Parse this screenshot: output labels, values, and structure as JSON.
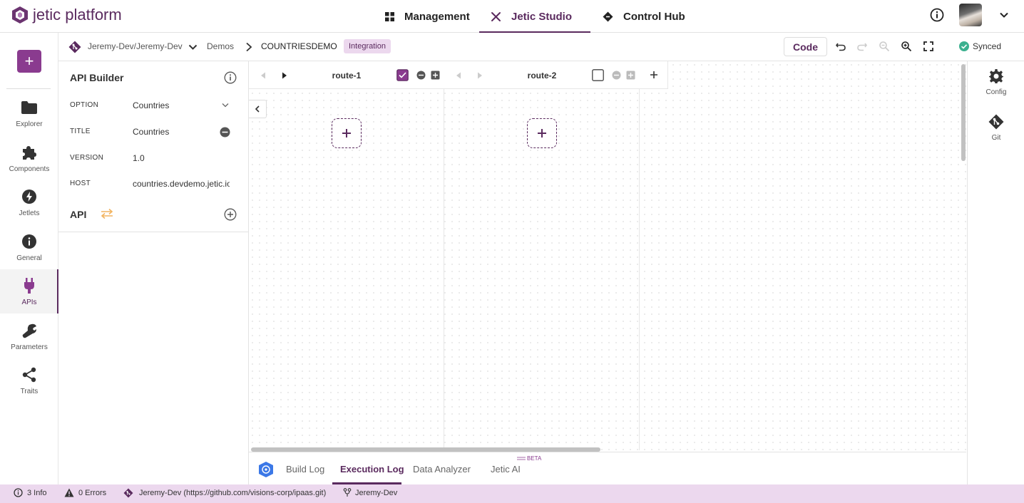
{
  "brand": {
    "name": "jetic platform"
  },
  "nav": {
    "tabs": [
      {
        "label": "Management",
        "icon": "grid-icon"
      },
      {
        "label": "Jetic Studio",
        "icon": "tools-icon",
        "active": true
      },
      {
        "label": "Control Hub",
        "icon": "hub-icon"
      }
    ]
  },
  "sidebar": {
    "items": [
      {
        "label": "Explorer",
        "icon": "folder-icon"
      },
      {
        "label": "Components",
        "icon": "puzzle-icon"
      },
      {
        "label": "Jetlets",
        "icon": "bolt-icon"
      },
      {
        "label": "General",
        "icon": "info-icon"
      },
      {
        "label": "APIs",
        "icon": "plug-icon",
        "active": true
      },
      {
        "label": "Parameters",
        "icon": "wrench-icon"
      },
      {
        "label": "Traits",
        "icon": "share-icon"
      }
    ]
  },
  "breadcrumb": {
    "repo": "Jeremy-Dev/Jeremy-Dev",
    "folder": "Demos",
    "item": "COUNTRIESDEMO",
    "badge": "Integration"
  },
  "toolbar": {
    "code_label": "Code",
    "sync_status": "Synced"
  },
  "api_builder": {
    "title": "API Builder",
    "fields": [
      {
        "key": "OPTION",
        "value": "Countries"
      },
      {
        "key": "TITLE",
        "value": "Countries"
      },
      {
        "key": "VERSION",
        "value": "1.0"
      },
      {
        "key": "HOST",
        "value": "countries.devdemo.jetic.io"
      }
    ],
    "api_section": "API"
  },
  "routes": [
    {
      "name": "route-1",
      "checked": true
    },
    {
      "name": "route-2",
      "checked": false
    }
  ],
  "right_rail": {
    "items": [
      {
        "label": "Config",
        "icon": "gear-icon"
      },
      {
        "label": "Git",
        "icon": "git-icon"
      }
    ]
  },
  "logs": {
    "tabs": [
      {
        "label": "Build Log"
      },
      {
        "label": "Execution Log",
        "active": true
      },
      {
        "label": "Data Analyzer"
      },
      {
        "label": "Jetic AI"
      }
    ],
    "beta": "BETA"
  },
  "status": {
    "info": "3 Info",
    "errors": "0 Errors",
    "repo": "Jeremy-Dev (https://github.com/visions-corp/ipaas.git)",
    "branch": "Jeremy-Dev"
  },
  "colors": {
    "primary": "#5a2a5e",
    "accent": "#8a3b8f",
    "status_bg": "#ecd8ee",
    "synced": "#3bb08f",
    "api_icon": "#f2b460"
  }
}
